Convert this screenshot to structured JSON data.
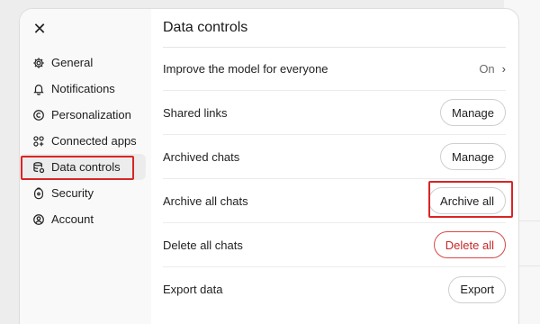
{
  "sidebar": {
    "close_icon": "close-icon",
    "items": [
      {
        "label": "General",
        "icon": "gear-icon"
      },
      {
        "label": "Notifications",
        "icon": "bell-icon"
      },
      {
        "label": "Personalization",
        "icon": "personalize-icon"
      },
      {
        "label": "Connected apps",
        "icon": "apps-icon"
      },
      {
        "label": "Data controls",
        "icon": "database-icon",
        "active": true
      },
      {
        "label": "Security",
        "icon": "security-icon"
      },
      {
        "label": "Account",
        "icon": "user-icon"
      }
    ]
  },
  "main": {
    "title": "Data controls",
    "rows": [
      {
        "label": "Improve the model for everyone",
        "control": "On"
      },
      {
        "label": "Shared links",
        "control": "Manage"
      },
      {
        "label": "Archived chats",
        "control": "Manage"
      },
      {
        "label": "Archive all chats",
        "control": "Archive all"
      },
      {
        "label": "Delete all chats",
        "control": "Delete all"
      },
      {
        "label": "Export data",
        "control": "Export"
      }
    ]
  },
  "colors": {
    "highlight": "#d92525",
    "danger": "#c62828",
    "sidebar_bg": "#f9f9f9"
  }
}
